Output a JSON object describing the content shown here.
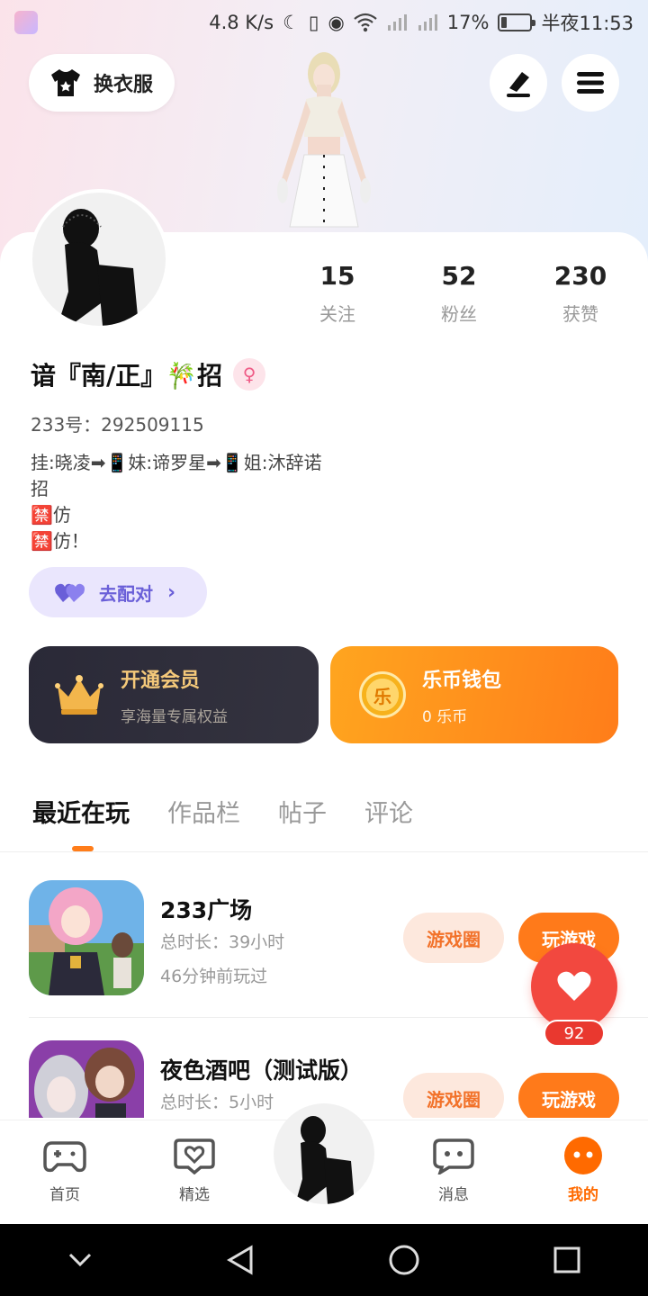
{
  "status_bar": {
    "speed": "4.8 K/s",
    "battery": "17%",
    "battery_level": 0.17,
    "time": "半夜11:53"
  },
  "header": {
    "dress_label": "换衣服"
  },
  "stats": [
    {
      "value": "15",
      "label": "关注"
    },
    {
      "value": "52",
      "label": "粉丝"
    },
    {
      "value": "230",
      "label": "获赞"
    }
  ],
  "profile": {
    "name": "谙『南/正』🎋招",
    "uid": "233号：292509115",
    "bio": "挂:晓凌➡📱妹:谛罗星➡📱姐:沐辞诺\n招\n🈲仿\n🈲仿！",
    "gender_icon": "female-icon"
  },
  "match": {
    "label": "去配对"
  },
  "vip": {
    "title": "开通会员",
    "subtitle": "享海量专属权益"
  },
  "wallet": {
    "title": "乐币钱包",
    "subtitle": "0 乐币",
    "coin_glyph": "乐"
  },
  "tabs": [
    {
      "label": "最近在玩",
      "active": true
    },
    {
      "label": "作品栏",
      "active": false
    },
    {
      "label": "帖子",
      "active": false
    },
    {
      "label": "评论",
      "active": false
    }
  ],
  "games": [
    {
      "title": "233广场",
      "duration": "总时长：39小时",
      "last_played": "46分钟前玩过",
      "circle_label": "游戏圈",
      "play_label": "玩游戏"
    },
    {
      "title": "夜色酒吧（测试版）",
      "duration": "总时长：5小时",
      "last_played": "",
      "circle_label": "游戏圈",
      "play_label": "玩游戏"
    }
  ],
  "favorite": {
    "count": "92"
  },
  "bottom_nav": [
    {
      "label": "首页",
      "icon": "gamepad-icon"
    },
    {
      "label": "精选",
      "icon": "heart-chat-icon"
    },
    {
      "label": "消息",
      "icon": "message-icon"
    },
    {
      "label": "我的",
      "icon": "profile-face-icon",
      "active": true
    }
  ],
  "colors": {
    "accent": "#ff7a1a",
    "favorite": "#f2483f",
    "match": "#6a5fd8"
  }
}
